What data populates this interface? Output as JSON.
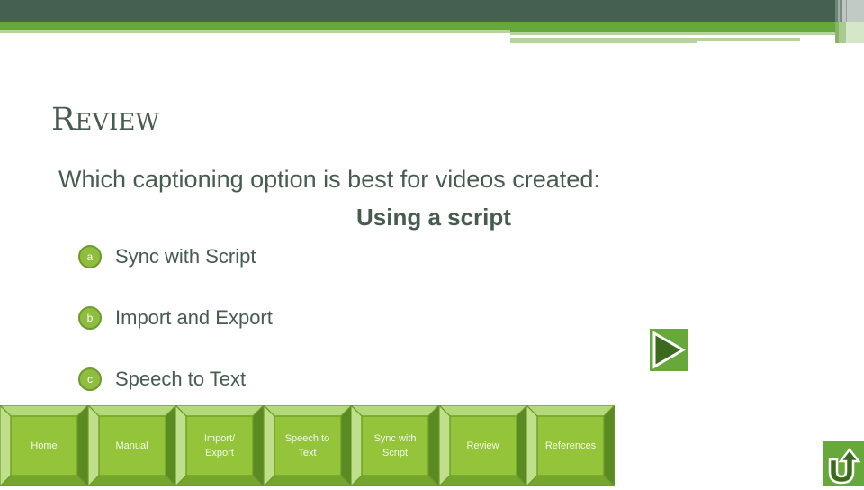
{
  "slide": {
    "title": "Review",
    "title_first_letter": "R",
    "title_rest": "EVIEW",
    "question": "Which captioning option is best for videos created:",
    "scenario": "Using a script"
  },
  "options": [
    {
      "letter": "a",
      "label": "Sync with Script"
    },
    {
      "letter": "b",
      "label": "Import and Export"
    },
    {
      "letter": "c",
      "label": "Speech to Text"
    }
  ],
  "navigation": {
    "next_icon": "play-triangle-icon",
    "return_icon": "u-turn-arrow-icon",
    "buttons": [
      {
        "label": "Home"
      },
      {
        "label": "Manual"
      },
      {
        "label": "Import/\nExport"
      },
      {
        "label": "Speech to\nText"
      },
      {
        "label": "Sync with\nScript"
      },
      {
        "label": "Review"
      },
      {
        "label": "References"
      }
    ]
  },
  "colors": {
    "dark_band": "#456050",
    "accent_green": "#66a83a",
    "light_green": "#b7d39e",
    "button_face": "#94c43a",
    "text": "#455c4e"
  }
}
